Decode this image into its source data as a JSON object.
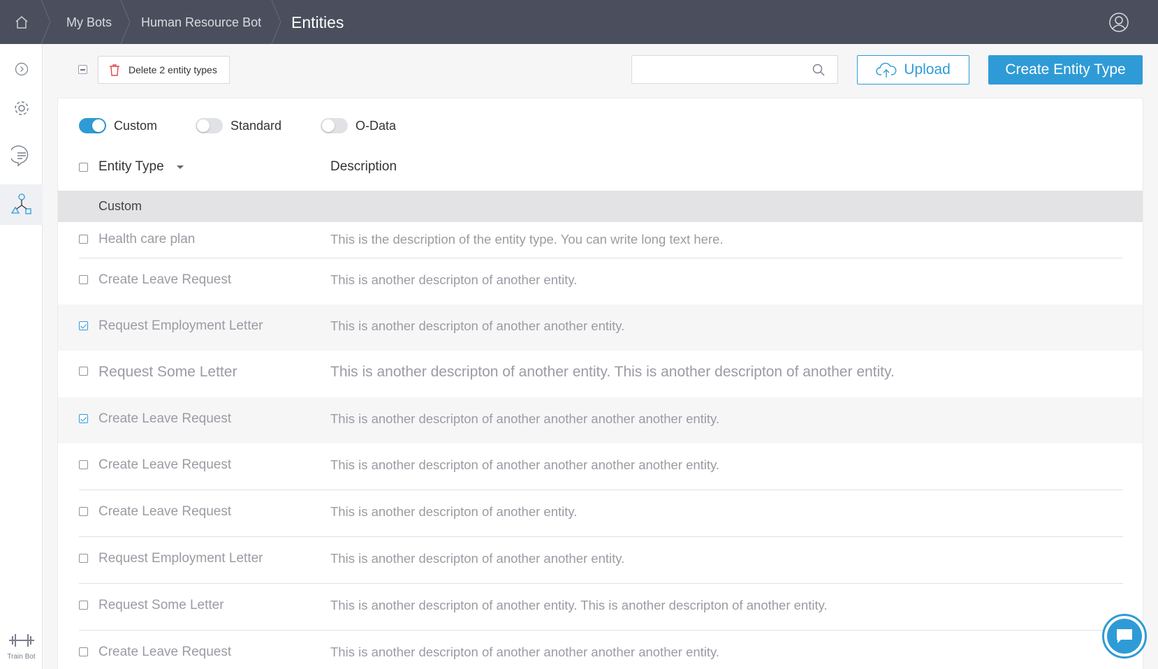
{
  "breadcrumb": {
    "items": [
      "My Bots",
      "Human Resource Bot"
    ],
    "current": "Entities"
  },
  "sidebar": {
    "train_label": "Train Bot"
  },
  "toolbar": {
    "delete_label": "Delete 2 entity types",
    "search_placeholder": "",
    "upload_label": "Upload",
    "create_label": "Create Entity Type"
  },
  "filters": {
    "custom": {
      "label": "Custom",
      "on": true
    },
    "standard": {
      "label": "Standard",
      "on": false
    },
    "odata": {
      "label": "O-Data",
      "on": false
    }
  },
  "table": {
    "col_entity": "Entity Type",
    "col_description": "Description",
    "group_label": "Custom",
    "rows": [
      {
        "name": "Health care plan",
        "description": "This is the description of the entity type. You can write long text here.",
        "checked": false
      },
      {
        "name": "Create Leave Request",
        "description": "This is another descripton of another entity.",
        "checked": false
      },
      {
        "name": "Request Employment Letter",
        "description": "This is another descripton of another another entity.",
        "checked": true
      },
      {
        "name": "Request Some Letter",
        "description": "This is another descripton of another entity. This is another descripton of another entity.",
        "checked": false
      },
      {
        "name": "Create Leave Request",
        "description": "This is another descripton of another another another another  entity.",
        "checked": true
      },
      {
        "name": "Create Leave Request",
        "description": "This is another descripton of another another another another  entity.",
        "checked": false
      },
      {
        "name": "Create Leave Request",
        "description": "This is another descripton of another entity.",
        "checked": false
      },
      {
        "name": "Request Employment Letter",
        "description": "This is another descripton of another another entity.",
        "checked": false
      },
      {
        "name": "Request Some Letter",
        "description": "This is another descripton of another entity. This is another descripton of another entity.",
        "checked": false
      },
      {
        "name": "Create Leave Request",
        "description": "This is another descripton of another another another another  entity.",
        "checked": false
      }
    ]
  },
  "colors": {
    "topbar": "#4b4f5d",
    "accent": "#2f9bd6",
    "delete_icon": "#e04848"
  }
}
